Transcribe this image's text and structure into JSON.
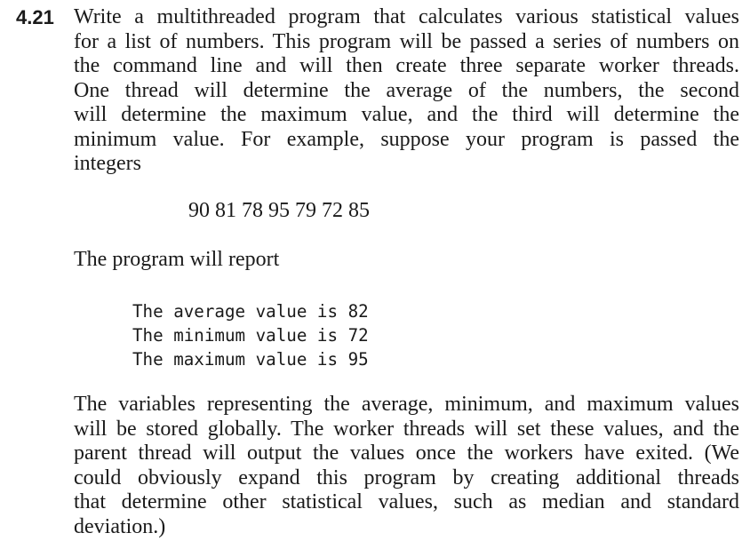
{
  "exercise": {
    "number": "4.21",
    "intro_lines": [
      "Write a multithreaded program that calculates various statistical values",
      "for a list of numbers. This program will be passed a series of numbers on",
      "the command line and will then create three separate worker threads.",
      "One thread will determine the average of the numbers, the second",
      "will determine the maximum value, and the third will determine the",
      "minimum value. For example, suppose your program is passed the",
      "integers"
    ],
    "example_numbers": "90 81 78 95 79 72 85",
    "report_intro": "The program will report",
    "output_lines": [
      "The average value is 82",
      "The minimum value is 72",
      "The maximum value is 95"
    ],
    "closing_lines": [
      "The variables representing the average, minimum, and maximum values",
      "will be stored globally. The worker threads will set these values, and the",
      "parent thread will output the values once the workers have exited. (We",
      "could obviously expand this program by creating additional threads",
      "that determine other statistical values, such as median and standard",
      "deviation.)"
    ]
  }
}
